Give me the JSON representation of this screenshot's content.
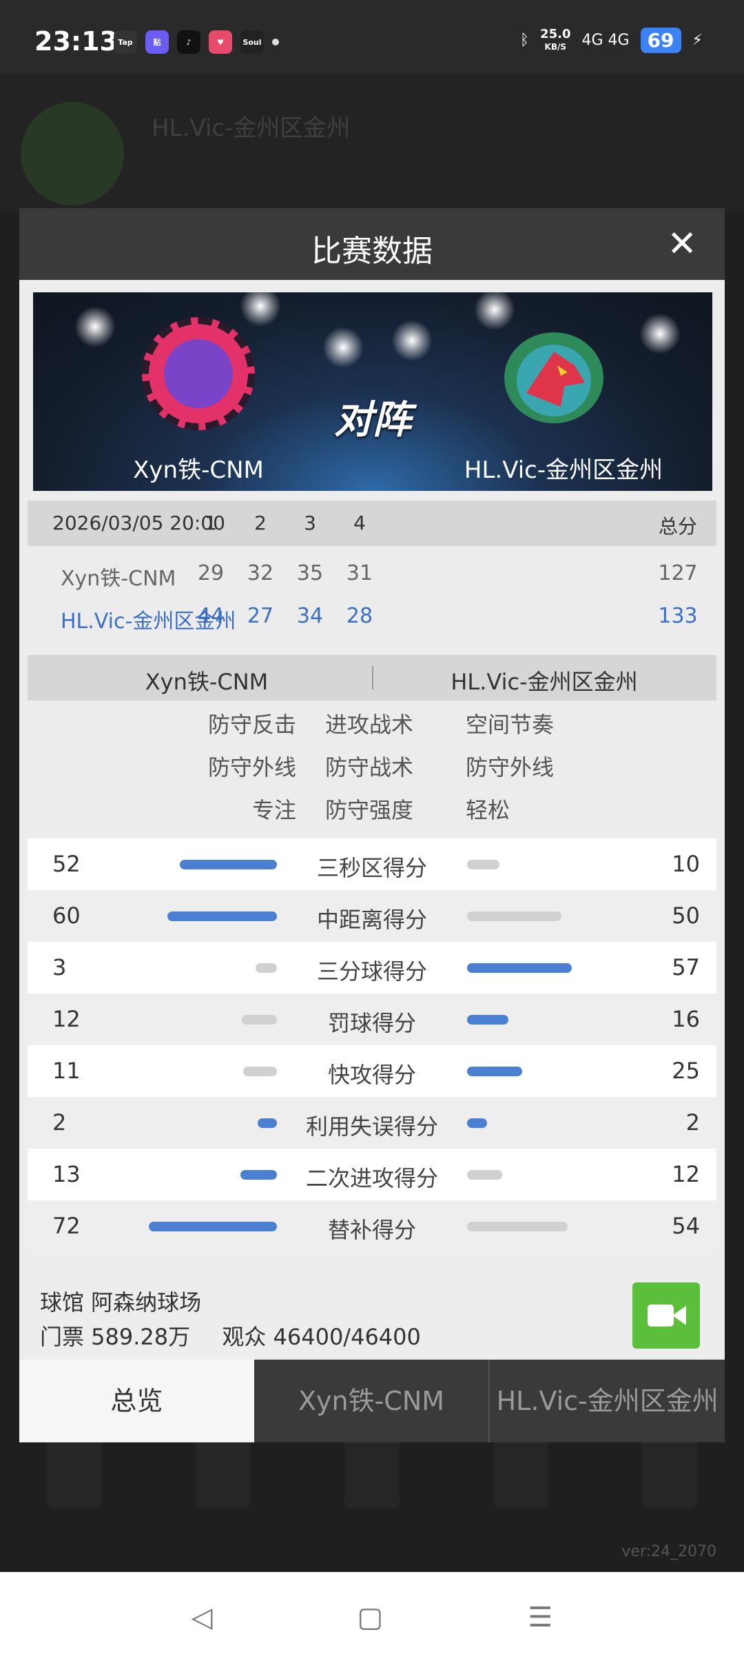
{
  "status_bar": {
    "time": "23:13",
    "apps": [
      "Tap",
      "贴",
      "♪",
      "♥",
      "Soul"
    ],
    "speed": "25.0",
    "speed_unit": "KB/S",
    "network": "4G 4G",
    "battery": "69"
  },
  "background": {
    "title": "HL.Vic-金州区金州",
    "version": "ver:24_2070"
  },
  "modal": {
    "title": "比赛数据",
    "close_icon": "close-icon"
  },
  "banner": {
    "home_team": "Xyn铁-CNM",
    "away_team": "HL.Vic-金州区金州",
    "vs": "对阵"
  },
  "score": {
    "datetime": "2026/03/05 20:00",
    "periods": [
      "1",
      "2",
      "3",
      "4"
    ],
    "total_label": "总分",
    "rows": [
      {
        "team": "Xyn铁-CNM",
        "q": [
          "29",
          "32",
          "35",
          "31"
        ],
        "total": "127"
      },
      {
        "team": "HL.Vic-金州区金州",
        "q": [
          "44",
          "27",
          "34",
          "28"
        ],
        "total": "133"
      }
    ]
  },
  "tactics": {
    "home": "Xyn铁-CNM",
    "away": "HL.Vic-金州区金州",
    "rows": [
      {
        "left": "防守反击",
        "mid": "进攻战术",
        "right": "空间节奏"
      },
      {
        "left": "防守外线",
        "mid": "防守战术",
        "right": "防守外线"
      },
      {
        "left": "专注",
        "mid": "防守强度",
        "right": "轻松"
      }
    ]
  },
  "stats": [
    {
      "label": "三秒区得分",
      "home": 52,
      "away": 10
    },
    {
      "label": "中距离得分",
      "home": 60,
      "away": 50
    },
    {
      "label": "三分球得分",
      "home": 3,
      "away": 57
    },
    {
      "label": "罚球得分",
      "home": 12,
      "away": 16
    },
    {
      "label": "快攻得分",
      "home": 11,
      "away": 25
    },
    {
      "label": "利用失误得分",
      "home": 2,
      "away": 2
    },
    {
      "label": "二次进攻得分",
      "home": 13,
      "away": 12
    },
    {
      "label": "替补得分",
      "home": 72,
      "away": 54
    }
  ],
  "footer": {
    "venue": "球馆 阿森纳球场",
    "tickets": "门票 589.28万",
    "audience": "观众 46400/46400"
  },
  "tabs": [
    "总览",
    "Xyn铁-CNM",
    "HL.Vic-金州区金州"
  ],
  "sysnav": {
    "back": "◁",
    "home": "▢",
    "menu": "☰"
  }
}
